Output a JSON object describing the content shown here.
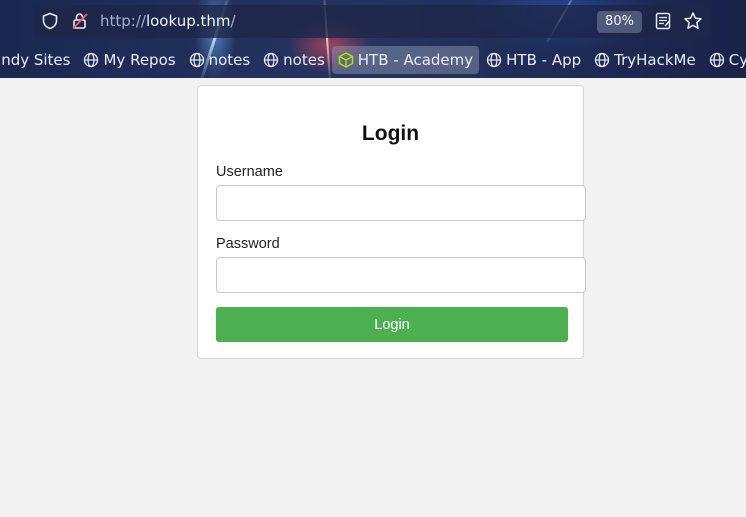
{
  "browser": {
    "url_scheme": "http://",
    "url_host": "lookup.thm",
    "url_path": "/",
    "zoom": "80%",
    "bookmarks": [
      {
        "label": "andy Sites",
        "icon": "none"
      },
      {
        "label": "My Repos",
        "icon": "globe-icon"
      },
      {
        "label": "notes",
        "icon": "globe-icon"
      },
      {
        "label": "notes",
        "icon": "globe-icon"
      },
      {
        "label": "HTB - Academy",
        "icon": "htb-cube-icon",
        "active": true
      },
      {
        "label": "HTB - App",
        "icon": "globe-icon"
      },
      {
        "label": "TryHackMe",
        "icon": "globe-icon"
      },
      {
        "label": "Cy",
        "icon": "globe-icon"
      }
    ]
  },
  "login": {
    "title": "Login",
    "username_label": "Username",
    "username_value": "",
    "password_label": "Password",
    "password_value": "",
    "submit_label": "Login"
  },
  "colors": {
    "accent": "#4caf50",
    "page_bg": "#f2f2f2",
    "htb_green": "#9fef00"
  }
}
